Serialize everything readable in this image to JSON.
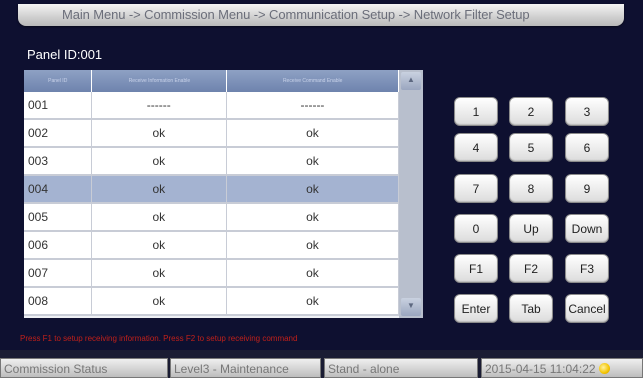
{
  "header": {
    "breadcrumb": "Main Menu -> Commission Menu -> Communication Setup -> Network Filter Setup"
  },
  "panel": {
    "label": "Panel ID:001"
  },
  "table": {
    "columns": [
      "Panel ID",
      "Receive Information Enable",
      "Receive Command Enable"
    ],
    "rows": [
      {
        "id": "001",
        "info": "------",
        "cmd": "------"
      },
      {
        "id": "002",
        "info": "ok",
        "cmd": "ok"
      },
      {
        "id": "003",
        "info": "ok",
        "cmd": "ok"
      },
      {
        "id": "004",
        "info": "ok",
        "cmd": "ok"
      },
      {
        "id": "005",
        "info": "ok",
        "cmd": "ok"
      },
      {
        "id": "006",
        "info": "ok",
        "cmd": "ok"
      },
      {
        "id": "007",
        "info": "ok",
        "cmd": "ok"
      },
      {
        "id": "008",
        "info": "ok",
        "cmd": "ok"
      }
    ],
    "selected_row": 3,
    "scroll_up_glyph": "▲",
    "scroll_down_glyph": "▼"
  },
  "keypad": {
    "keys": [
      "1",
      "2",
      "3",
      "4",
      "5",
      "6",
      "7",
      "8",
      "9",
      "0",
      "Up",
      "Down",
      "F1",
      "F2",
      "F3",
      "Enter",
      "Tab",
      "Cancel"
    ]
  },
  "warning": "Press F1 to setup receiving information. Press F2 to setup receiving command",
  "status": {
    "label": "Commission Status",
    "level": "Level3 - Maintenance",
    "mode": "Stand - alone",
    "datetime": "2015-04-15 11:04:22"
  }
}
